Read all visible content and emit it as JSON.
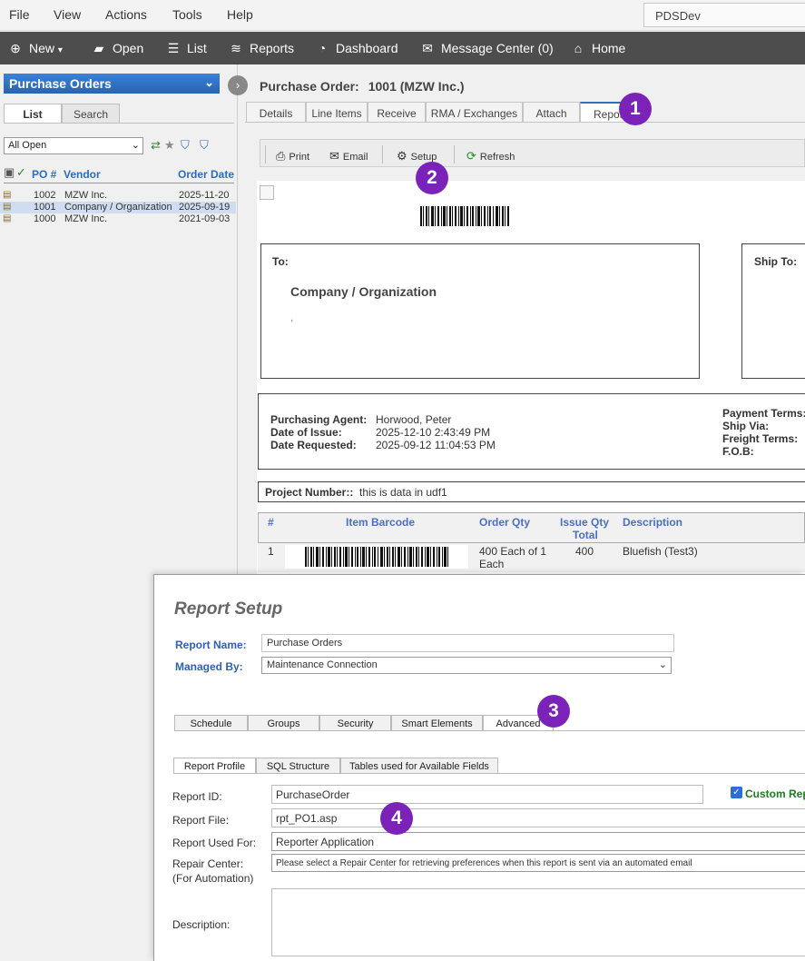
{
  "menu": [
    "File",
    "View",
    "Actions",
    "Tools",
    "Help"
  ],
  "environment": "PDSDev",
  "toolbar": {
    "new": "New",
    "open": "Open",
    "list": "List",
    "reports": "Reports",
    "dashboard": "Dashboard",
    "message_center": "Message Center (0)",
    "home": "Home"
  },
  "left_panel": {
    "title": "Purchase Orders",
    "tabs": [
      "List",
      "Search"
    ],
    "filter": "All Open",
    "columns": [
      "PO #",
      "Vendor",
      "Order Date"
    ],
    "rows": [
      {
        "po": "1002",
        "vendor": "MZW Inc.",
        "date": "2025-11-20"
      },
      {
        "po": "1001",
        "vendor": "Company / Organization",
        "date": "2025-09-19"
      },
      {
        "po": "1000",
        "vendor": "MZW Inc.",
        "date": "2021-09-03"
      }
    ]
  },
  "detail": {
    "title_label": "Purchase Order:",
    "title_value": "1001 (MZW Inc.)",
    "tabs": [
      "Details",
      "Line Items",
      "Receive",
      "RMA / Exchanges",
      "Attach",
      "Repor"
    ],
    "report_toolbar": {
      "print": "Print",
      "email": "Email",
      "setup": "Setup",
      "refresh": "Refresh"
    }
  },
  "report": {
    "to_label": "To:",
    "ship_to_label": "Ship To:",
    "to_name": "Company / Organization",
    "to_line2": ",",
    "purchasing_agent_label": "Purchasing Agent:",
    "purchasing_agent": "Horwood, Peter",
    "date_of_issue_label": "Date of Issue:",
    "date_of_issue": "2025-12-10 2:43:49 PM",
    "date_requested_label": "Date Requested:",
    "date_requested": "2025-09-12 11:04:53 PM",
    "payment_terms_label": "Payment Terms:",
    "ship_via_label": "Ship Via:",
    "freight_terms_label": "Freight Terms:",
    "fob_label": "F.O.B:",
    "project_number_label": "Project Number::",
    "project_number": "this is data in udf1",
    "items_columns": {
      "num": "#",
      "barcode": "Item Barcode",
      "order_qty": "Order Qty",
      "issue_qty_1": "Issue Qty",
      "issue_qty_2": "Total",
      "description": "Description"
    },
    "item": {
      "num": "1",
      "order_qty_1": "400 Each of 1",
      "order_qty_2": "Each",
      "issue_qty": "400",
      "description": "Bluefish (Test3)"
    }
  },
  "dialog": {
    "title": "Report Setup",
    "report_name_label": "Report Name:",
    "report_name": "Purchase Orders",
    "managed_by_label": "Managed By:",
    "managed_by": "Maintenance Connection",
    "tabs": [
      "Schedule",
      "Groups",
      "Security",
      "Smart Elements",
      "Advanced"
    ],
    "subtabs": [
      "Report Profile",
      "SQL Structure",
      "Tables used for Available Fields"
    ],
    "report_id_label": "Report ID:",
    "report_id": "PurchaseOrder",
    "custom_report_label": "Custom Rep",
    "report_file_label": "Report File:",
    "report_file": "rpt_PO1.asp",
    "report_used_for_label": "Report Used For:",
    "report_used_for": "Reporter Application",
    "repair_center_label_1": "Repair Center:",
    "repair_center_label_2": "(For Automation)",
    "repair_center": "Please select a Repair Center for retrieving preferences when this report is sent via an automated email",
    "description_label": "Description:"
  },
  "markers": [
    "1",
    "2",
    "3",
    "4"
  ],
  "colors": {
    "accent": "#2f6cb9",
    "marker": "#7b22b8",
    "toolbar": "#4d4d4d"
  }
}
